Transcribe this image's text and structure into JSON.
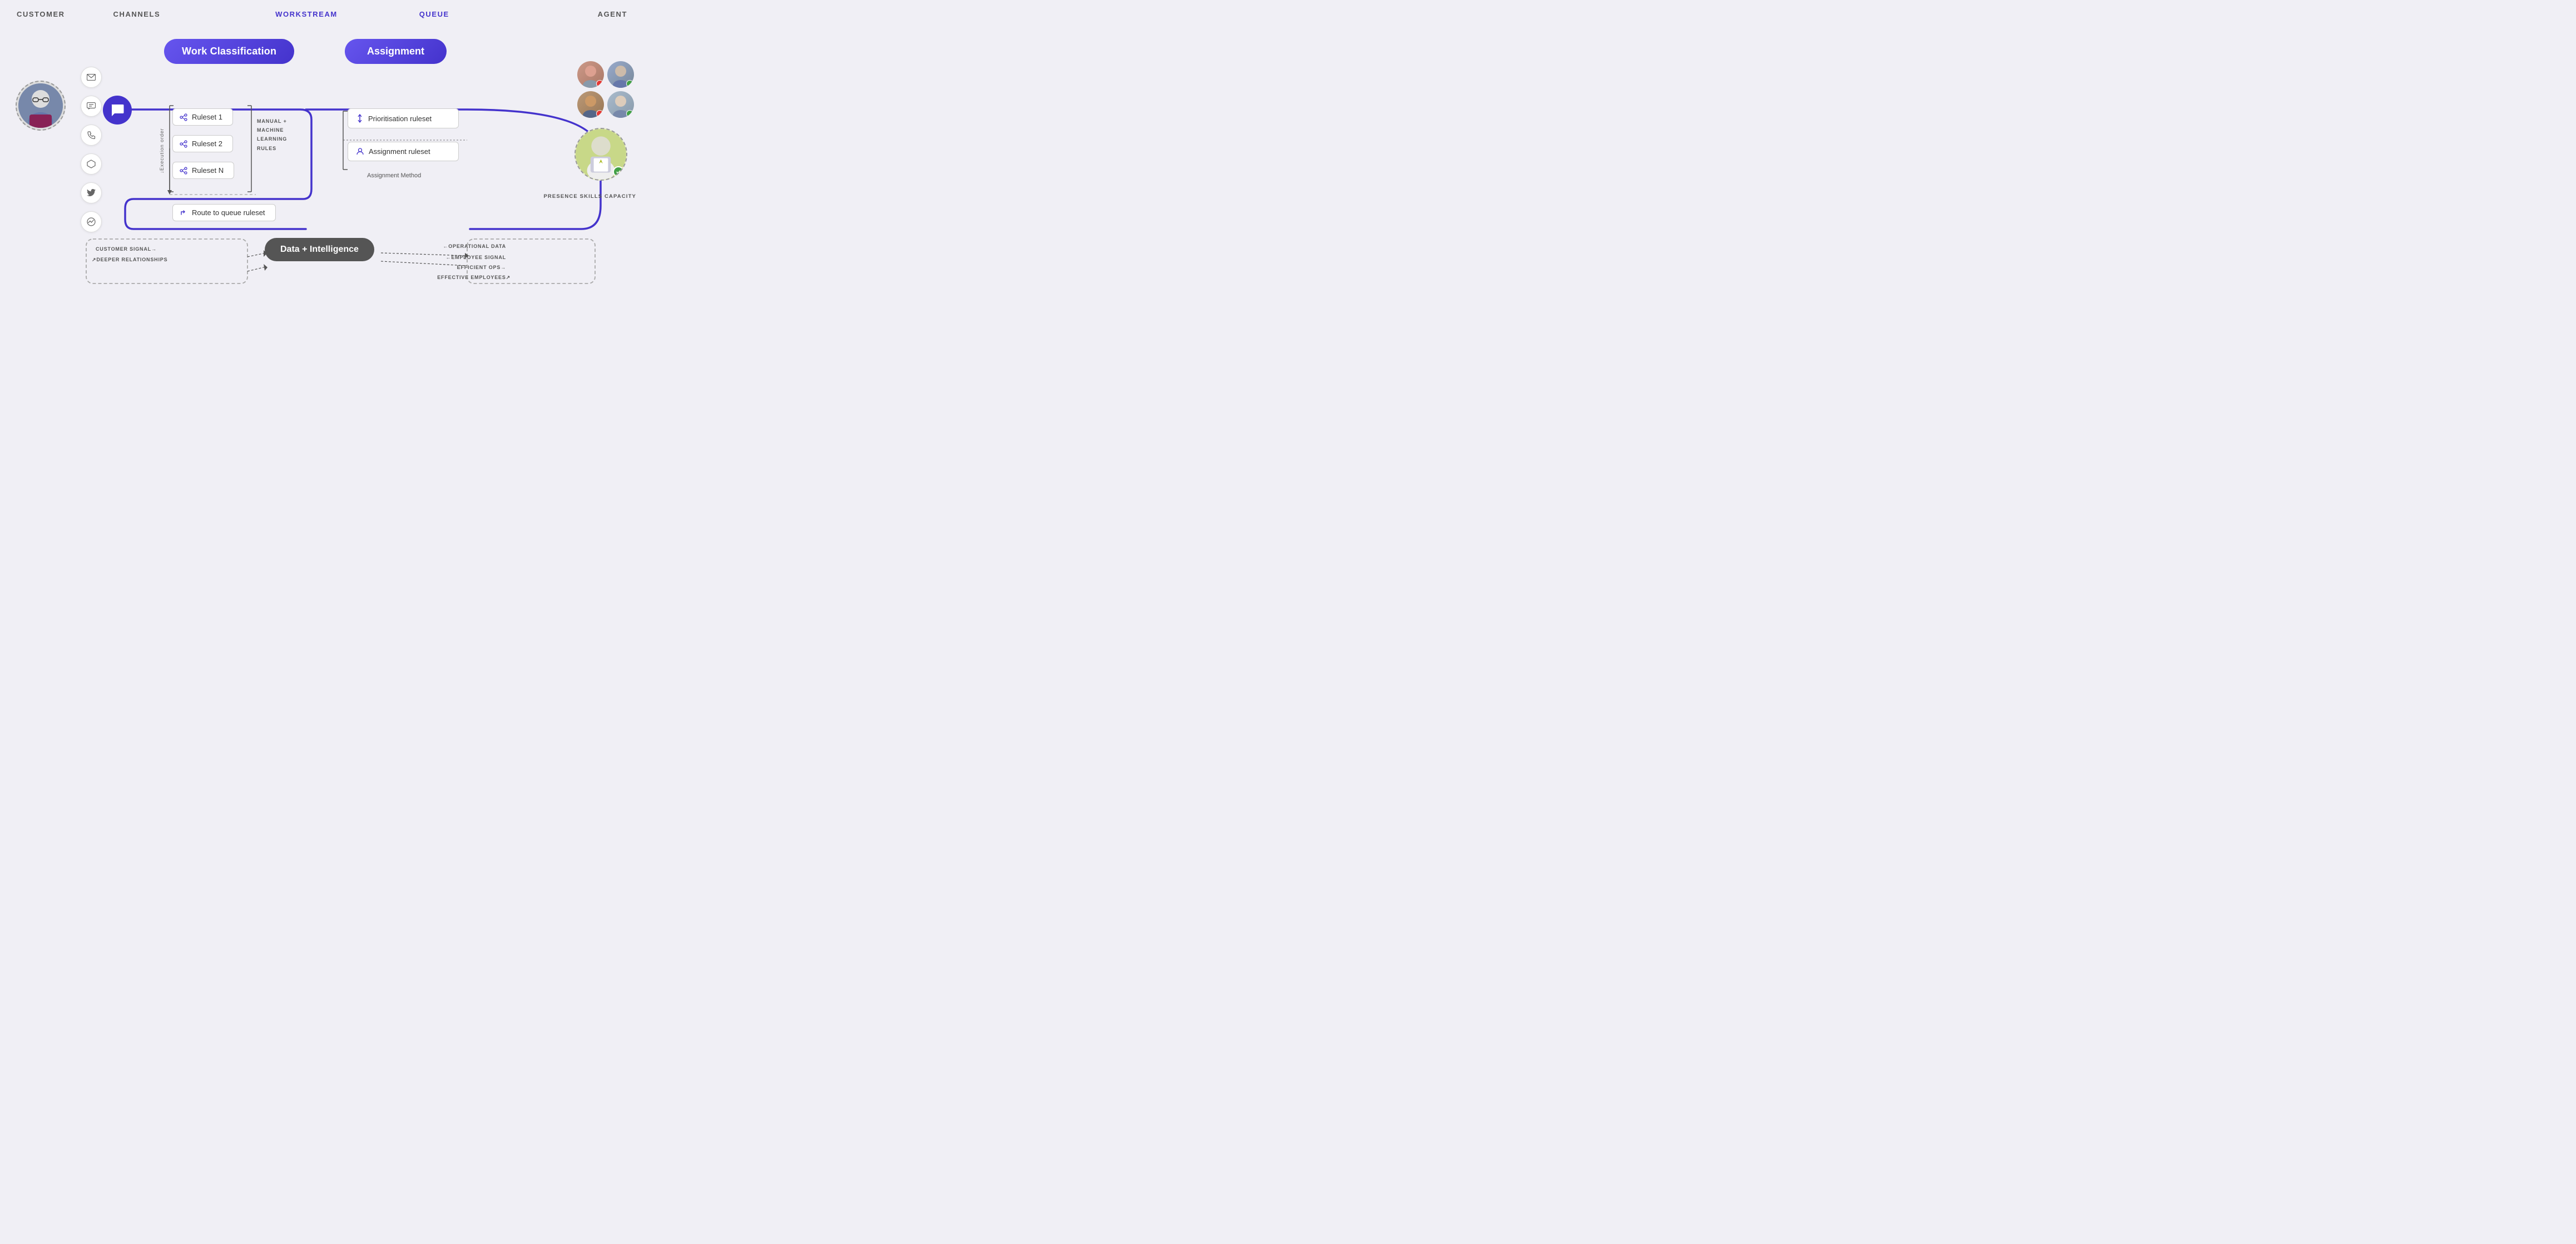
{
  "header": {
    "customer_label": "CUSTOMER",
    "channels_label": "CHANNELS",
    "workstream_label": "WORKSTREAM",
    "queue_label": "QUEUE",
    "agent_label": "AGENT"
  },
  "badges": {
    "work_classification": "Work Classification",
    "assignment": "Assignment",
    "data_intelligence": "Data + Intelligence"
  },
  "channels": [
    {
      "icon": "✉",
      "name": "email-icon"
    },
    {
      "icon": "💬",
      "name": "sms-icon"
    },
    {
      "icon": "📞",
      "name": "phone-icon"
    },
    {
      "icon": "⬡",
      "name": "widget-icon"
    },
    {
      "icon": "🐦",
      "name": "twitter-icon"
    },
    {
      "icon": "💙",
      "name": "messenger-icon"
    }
  ],
  "rulesets": [
    {
      "label": "Ruleset 1"
    },
    {
      "label": "Ruleset 2"
    },
    {
      "label": "Ruleset N"
    }
  ],
  "manual_label": "MANUAL +\nMACHINE\nLEARNING\nRULES",
  "execution_order_label": "Execution order",
  "route_ruleset_label": "Route to queue ruleset",
  "assignment_items": [
    {
      "label": "Prioritisation ruleset"
    },
    {
      "label": "Assignment ruleset"
    }
  ],
  "assignment_method_label": "Assignment Method",
  "data_labels": {
    "customer_signal": "CUSTOMER SIGNAL→",
    "deeper_relationships": "↗DEEPER RELATIONSHIPS",
    "operational_data": "←OPERATIONAL DATA",
    "employee_signal": "←EMPLOYEE SIGNAL",
    "efficient_ops": "EFFICIENT OPS→",
    "effective_employees": "EFFECTIVE EMPLOYEES→"
  },
  "presence_labels": "PRESENCE\nSKILLS\nCAPACITY",
  "colors": {
    "primary": "#4433cc",
    "primary_gradient_start": "#6655ee",
    "background": "#f0eff5",
    "white": "#ffffff",
    "text_dark": "#333333",
    "text_medium": "#555555",
    "data_pill_bg": "#555555"
  }
}
